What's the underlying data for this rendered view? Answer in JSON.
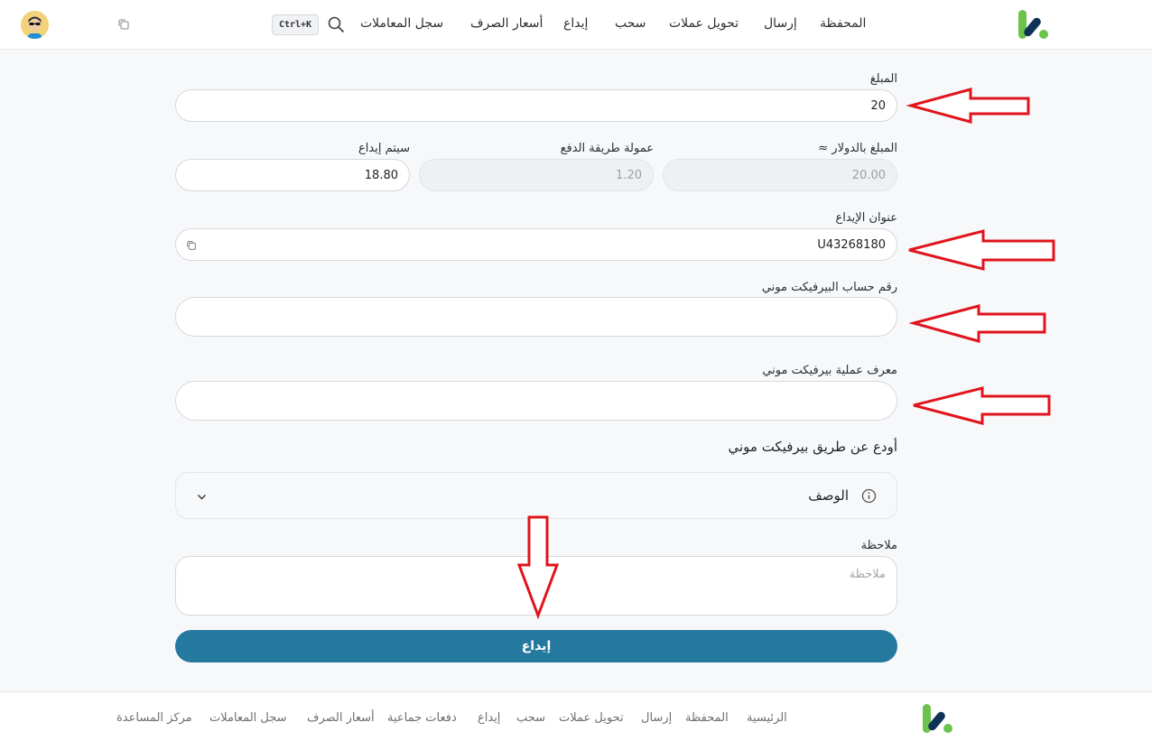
{
  "header": {
    "nav": [
      "المحفظة",
      "إرسال",
      "تحويل عملات",
      "سحب",
      "إيداع",
      "أسعار الصرف",
      "سجل المعاملات"
    ],
    "shortcut": "Ctrl+K"
  },
  "form": {
    "amount_label": "المبلغ",
    "amount_value": "20",
    "usd_label": "المبلغ بالدولار ≈",
    "usd_value": "20.00",
    "fee_label": "عمولة طريقة الدفع",
    "fee_value": "1.20",
    "deposit_label": "سيتم إيداع",
    "deposit_value": "18.80",
    "address_label": "عنوان الإيداع",
    "address_value": "U43268180",
    "account_label": "رقم حساب البيرفيكت موني",
    "account_value": "",
    "txid_label": "معرف عملية بيرفيكت موني",
    "txid_value": "",
    "section_title": "أودع عن طريق بيرفيكت موني",
    "accordion_title": "الوصف",
    "note_label": "ملاحظة",
    "note_placeholder": "ملاحظة",
    "submit_label": "إيداع"
  },
  "footer": {
    "links": [
      "الرئيسية",
      "المحفظة",
      "إرسال",
      "تحويل عملات",
      "سحب",
      "إيداع",
      "دفعات جماعية",
      "أسعار الصرف",
      "سجل المعاملات",
      "مركز المساعدة"
    ]
  },
  "colors": {
    "accent": "#25799f",
    "brand_green": "#6cc24a",
    "brand_navy": "#0f3357",
    "annotation": "#e0141c"
  },
  "icons": {
    "logo": "brand-logo-icon",
    "avatar": "user-avatar",
    "copy": "copy-icon",
    "search": "search-icon",
    "info": "info-icon",
    "chevron": "chevron-down-icon"
  }
}
